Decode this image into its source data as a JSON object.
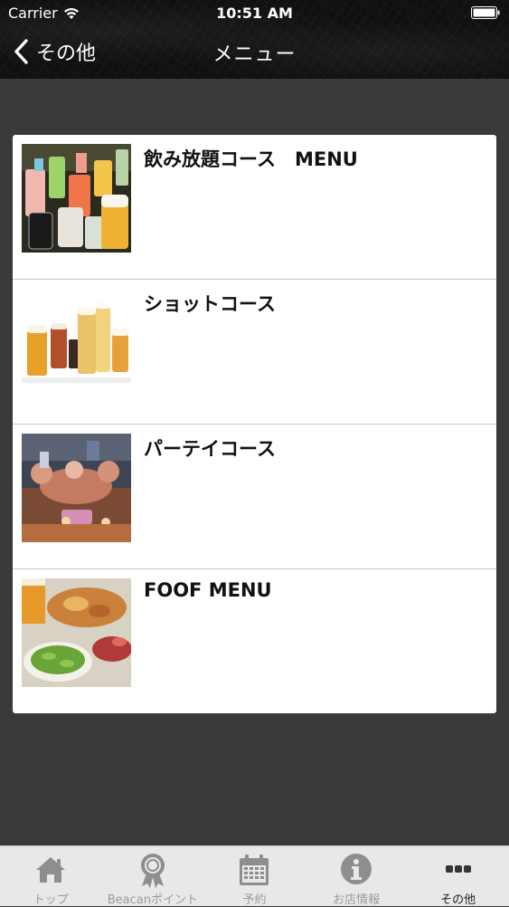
{
  "status_bar": {
    "carrier": "Carrier",
    "time": "10:51 AM"
  },
  "nav": {
    "back_label": "その他",
    "title": "メニュー"
  },
  "menu_items": [
    {
      "label": "飲み放題コース　MENU",
      "image": "drinks-assortment-photo"
    },
    {
      "label": "ショットコース",
      "image": "beer-glasses-photo"
    },
    {
      "label": "パーテイコース",
      "image": "party-toast-photo"
    },
    {
      "label": "FOOF MENU",
      "image": "food-platter-photo"
    }
  ],
  "tabs": [
    {
      "label": "トップ",
      "icon": "home-icon",
      "active": false
    },
    {
      "label": "Beacanポイント",
      "icon": "award-ribbon-icon",
      "active": false
    },
    {
      "label": "予約",
      "icon": "calendar-icon",
      "active": false
    },
    {
      "label": "お店情報",
      "icon": "info-icon",
      "active": false
    },
    {
      "label": "その他",
      "icon": "more-dots-icon",
      "active": true
    }
  ],
  "colors": {
    "page_background": "#3a393b",
    "header_background": "#111111",
    "tab_bar_background": "#e8e8e8",
    "tab_inactive": "#9b9b9b",
    "tab_active": "#222222"
  }
}
